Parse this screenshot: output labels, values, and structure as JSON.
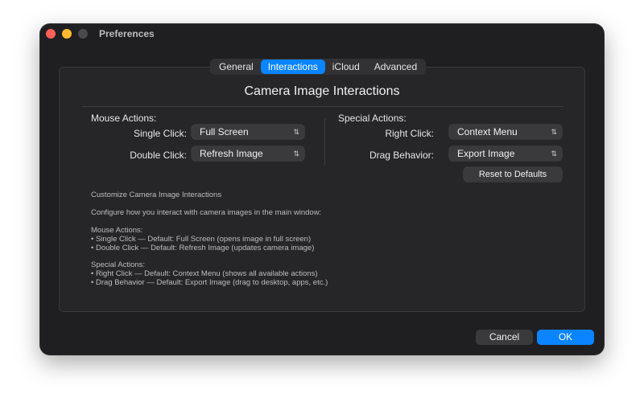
{
  "window": {
    "title": "Preferences",
    "colors": {
      "close": "#fe5f57",
      "minimize": "#febc2e",
      "zoom": "#4a4a4c",
      "accent": "#0a84ff"
    }
  },
  "tabs": [
    {
      "label": "General",
      "active": false
    },
    {
      "label": "Interactions",
      "active": true
    },
    {
      "label": "iCloud",
      "active": false
    },
    {
      "label": "Advanced",
      "active": false
    }
  ],
  "panel": {
    "heading": "Camera Image Interactions",
    "mouse": {
      "section_label": "Mouse Actions:",
      "single_click": {
        "label": "Single Click:",
        "value": "Full Screen"
      },
      "double_click": {
        "label": "Double Click:",
        "value": "Refresh Image"
      }
    },
    "special": {
      "section_label": "Special Actions:",
      "right_click": {
        "label": "Right Click:",
        "value": "Context Menu"
      },
      "drag_behavior": {
        "label": "Drag Behavior:",
        "value": "Export Image"
      },
      "reset_button": "Reset to Defaults"
    },
    "description": {
      "title": "Customize Camera Image Interactions",
      "intro": "Configure how you interact with camera images in the main window:",
      "mouse_header": "Mouse Actions:",
      "mouse_lines": [
        "• Single Click — Default: Full Screen (opens image in full screen)",
        "• Double Click — Default: Refresh Image (updates camera image)"
      ],
      "special_header": "Special Actions:",
      "special_lines": [
        "• Right Click — Default: Context Menu (shows all available actions)",
        "• Drag Behavior — Default: Export Image (drag to desktop, apps, etc.)"
      ]
    }
  },
  "footer": {
    "cancel": "Cancel",
    "ok": "OK"
  }
}
